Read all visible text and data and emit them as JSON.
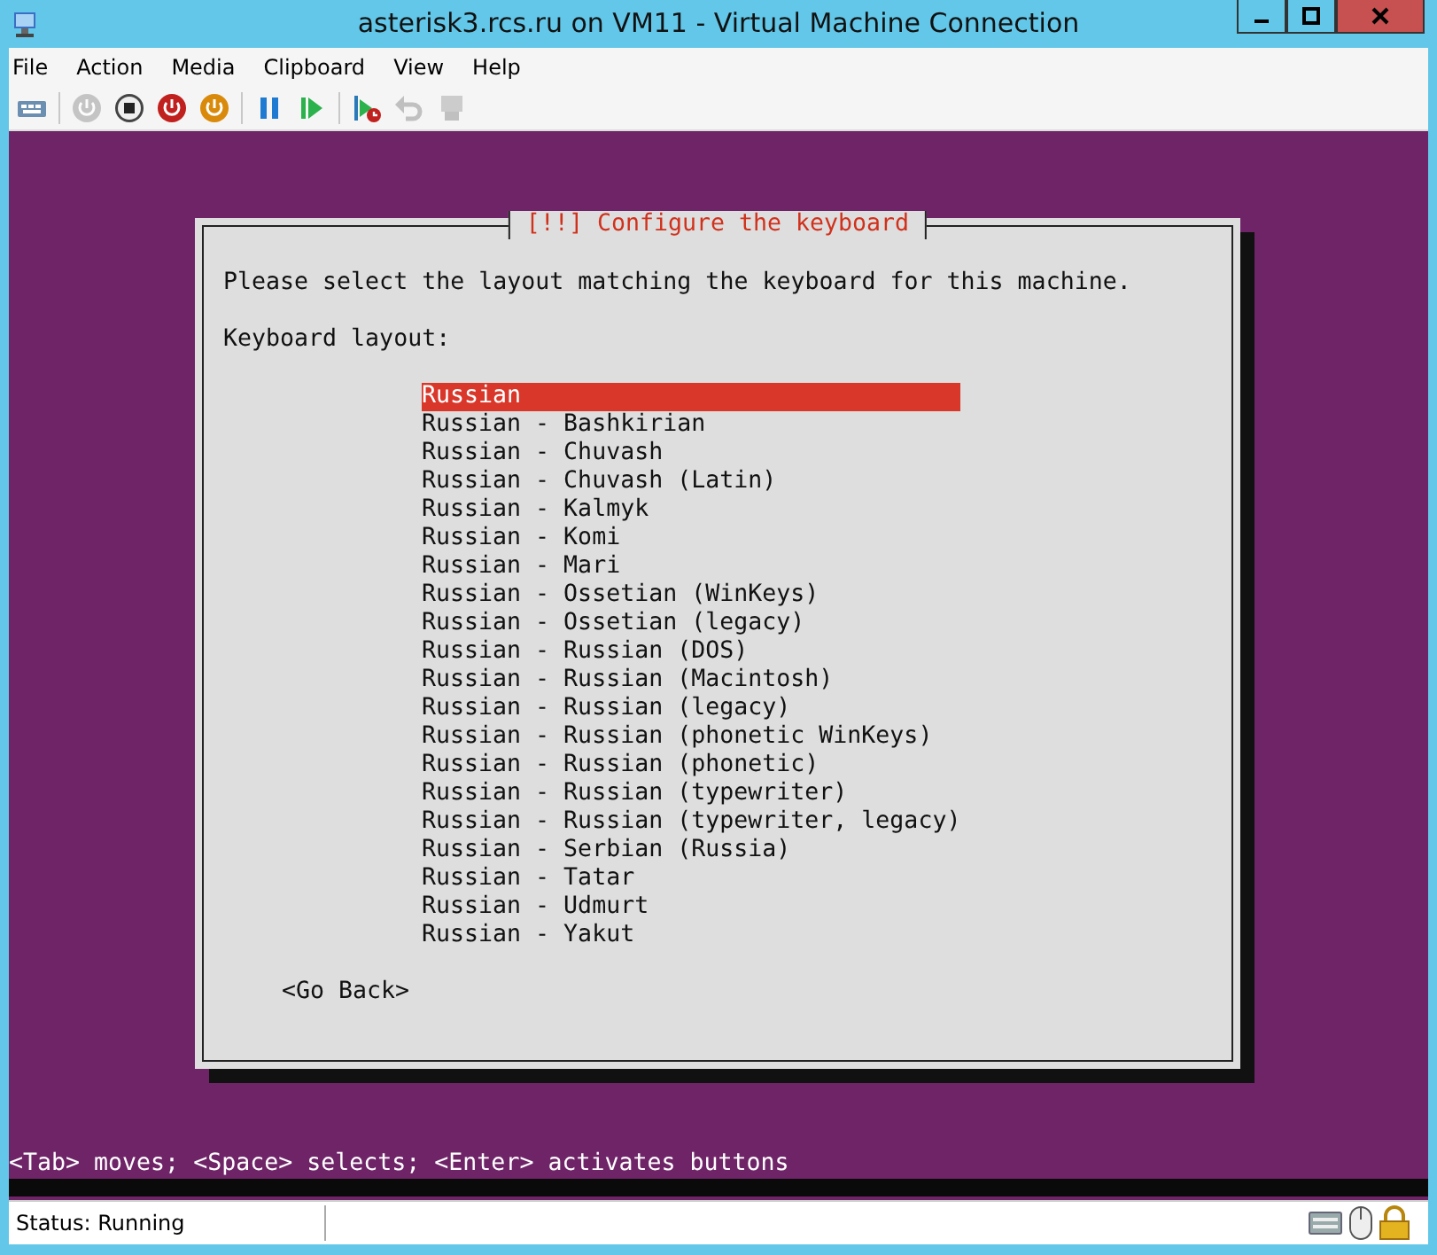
{
  "window": {
    "title": "asterisk3.rcs.ru on VM11 - Virtual Machine Connection"
  },
  "menu": [
    "File",
    "Action",
    "Media",
    "Clipboard",
    "View",
    "Help"
  ],
  "toolbar": [
    {
      "kind": "ctrl-alt-del",
      "disabled": false
    },
    {
      "kind": "start",
      "disabled": true
    },
    {
      "kind": "turn-off",
      "disabled": false
    },
    {
      "kind": "shutdown",
      "disabled": false
    },
    {
      "kind": "save",
      "disabled": false
    },
    {
      "kind": "pause",
      "disabled": false
    },
    {
      "kind": "resume",
      "disabled": false
    },
    {
      "kind": "checkpoint",
      "disabled": false
    },
    {
      "kind": "revert",
      "disabled": true
    },
    {
      "kind": "enhanced",
      "disabled": true
    }
  ],
  "dialog": {
    "title": "[!!] Configure the keyboard",
    "prompt": "Please select the layout matching the keyboard for this machine.",
    "list_label": "Keyboard layout:",
    "items": [
      {
        "label": "Russian",
        "selected": true
      },
      {
        "label": "Russian - Bashkirian",
        "selected": false
      },
      {
        "label": "Russian - Chuvash",
        "selected": false
      },
      {
        "label": "Russian - Chuvash (Latin)",
        "selected": false
      },
      {
        "label": "Russian - Kalmyk",
        "selected": false
      },
      {
        "label": "Russian - Komi",
        "selected": false
      },
      {
        "label": "Russian - Mari",
        "selected": false
      },
      {
        "label": "Russian - Ossetian (WinKeys)",
        "selected": false
      },
      {
        "label": "Russian - Ossetian (legacy)",
        "selected": false
      },
      {
        "label": "Russian - Russian (DOS)",
        "selected": false
      },
      {
        "label": "Russian - Russian (Macintosh)",
        "selected": false
      },
      {
        "label": "Russian - Russian (legacy)",
        "selected": false
      },
      {
        "label": "Russian - Russian (phonetic WinKeys)",
        "selected": false
      },
      {
        "label": "Russian - Russian (phonetic)",
        "selected": false
      },
      {
        "label": "Russian - Russian (typewriter)",
        "selected": false
      },
      {
        "label": "Russian - Russian (typewriter, legacy)",
        "selected": false
      },
      {
        "label": "Russian - Serbian (Russia)",
        "selected": false
      },
      {
        "label": "Russian - Tatar",
        "selected": false
      },
      {
        "label": "Russian - Udmurt",
        "selected": false
      },
      {
        "label": "Russian - Yakut",
        "selected": false
      }
    ],
    "back_button": "<Go Back>"
  },
  "help_line": "<Tab> moves; <Space> selects; <Enter> activates buttons",
  "status_bar": {
    "status": "Status: Running"
  }
}
